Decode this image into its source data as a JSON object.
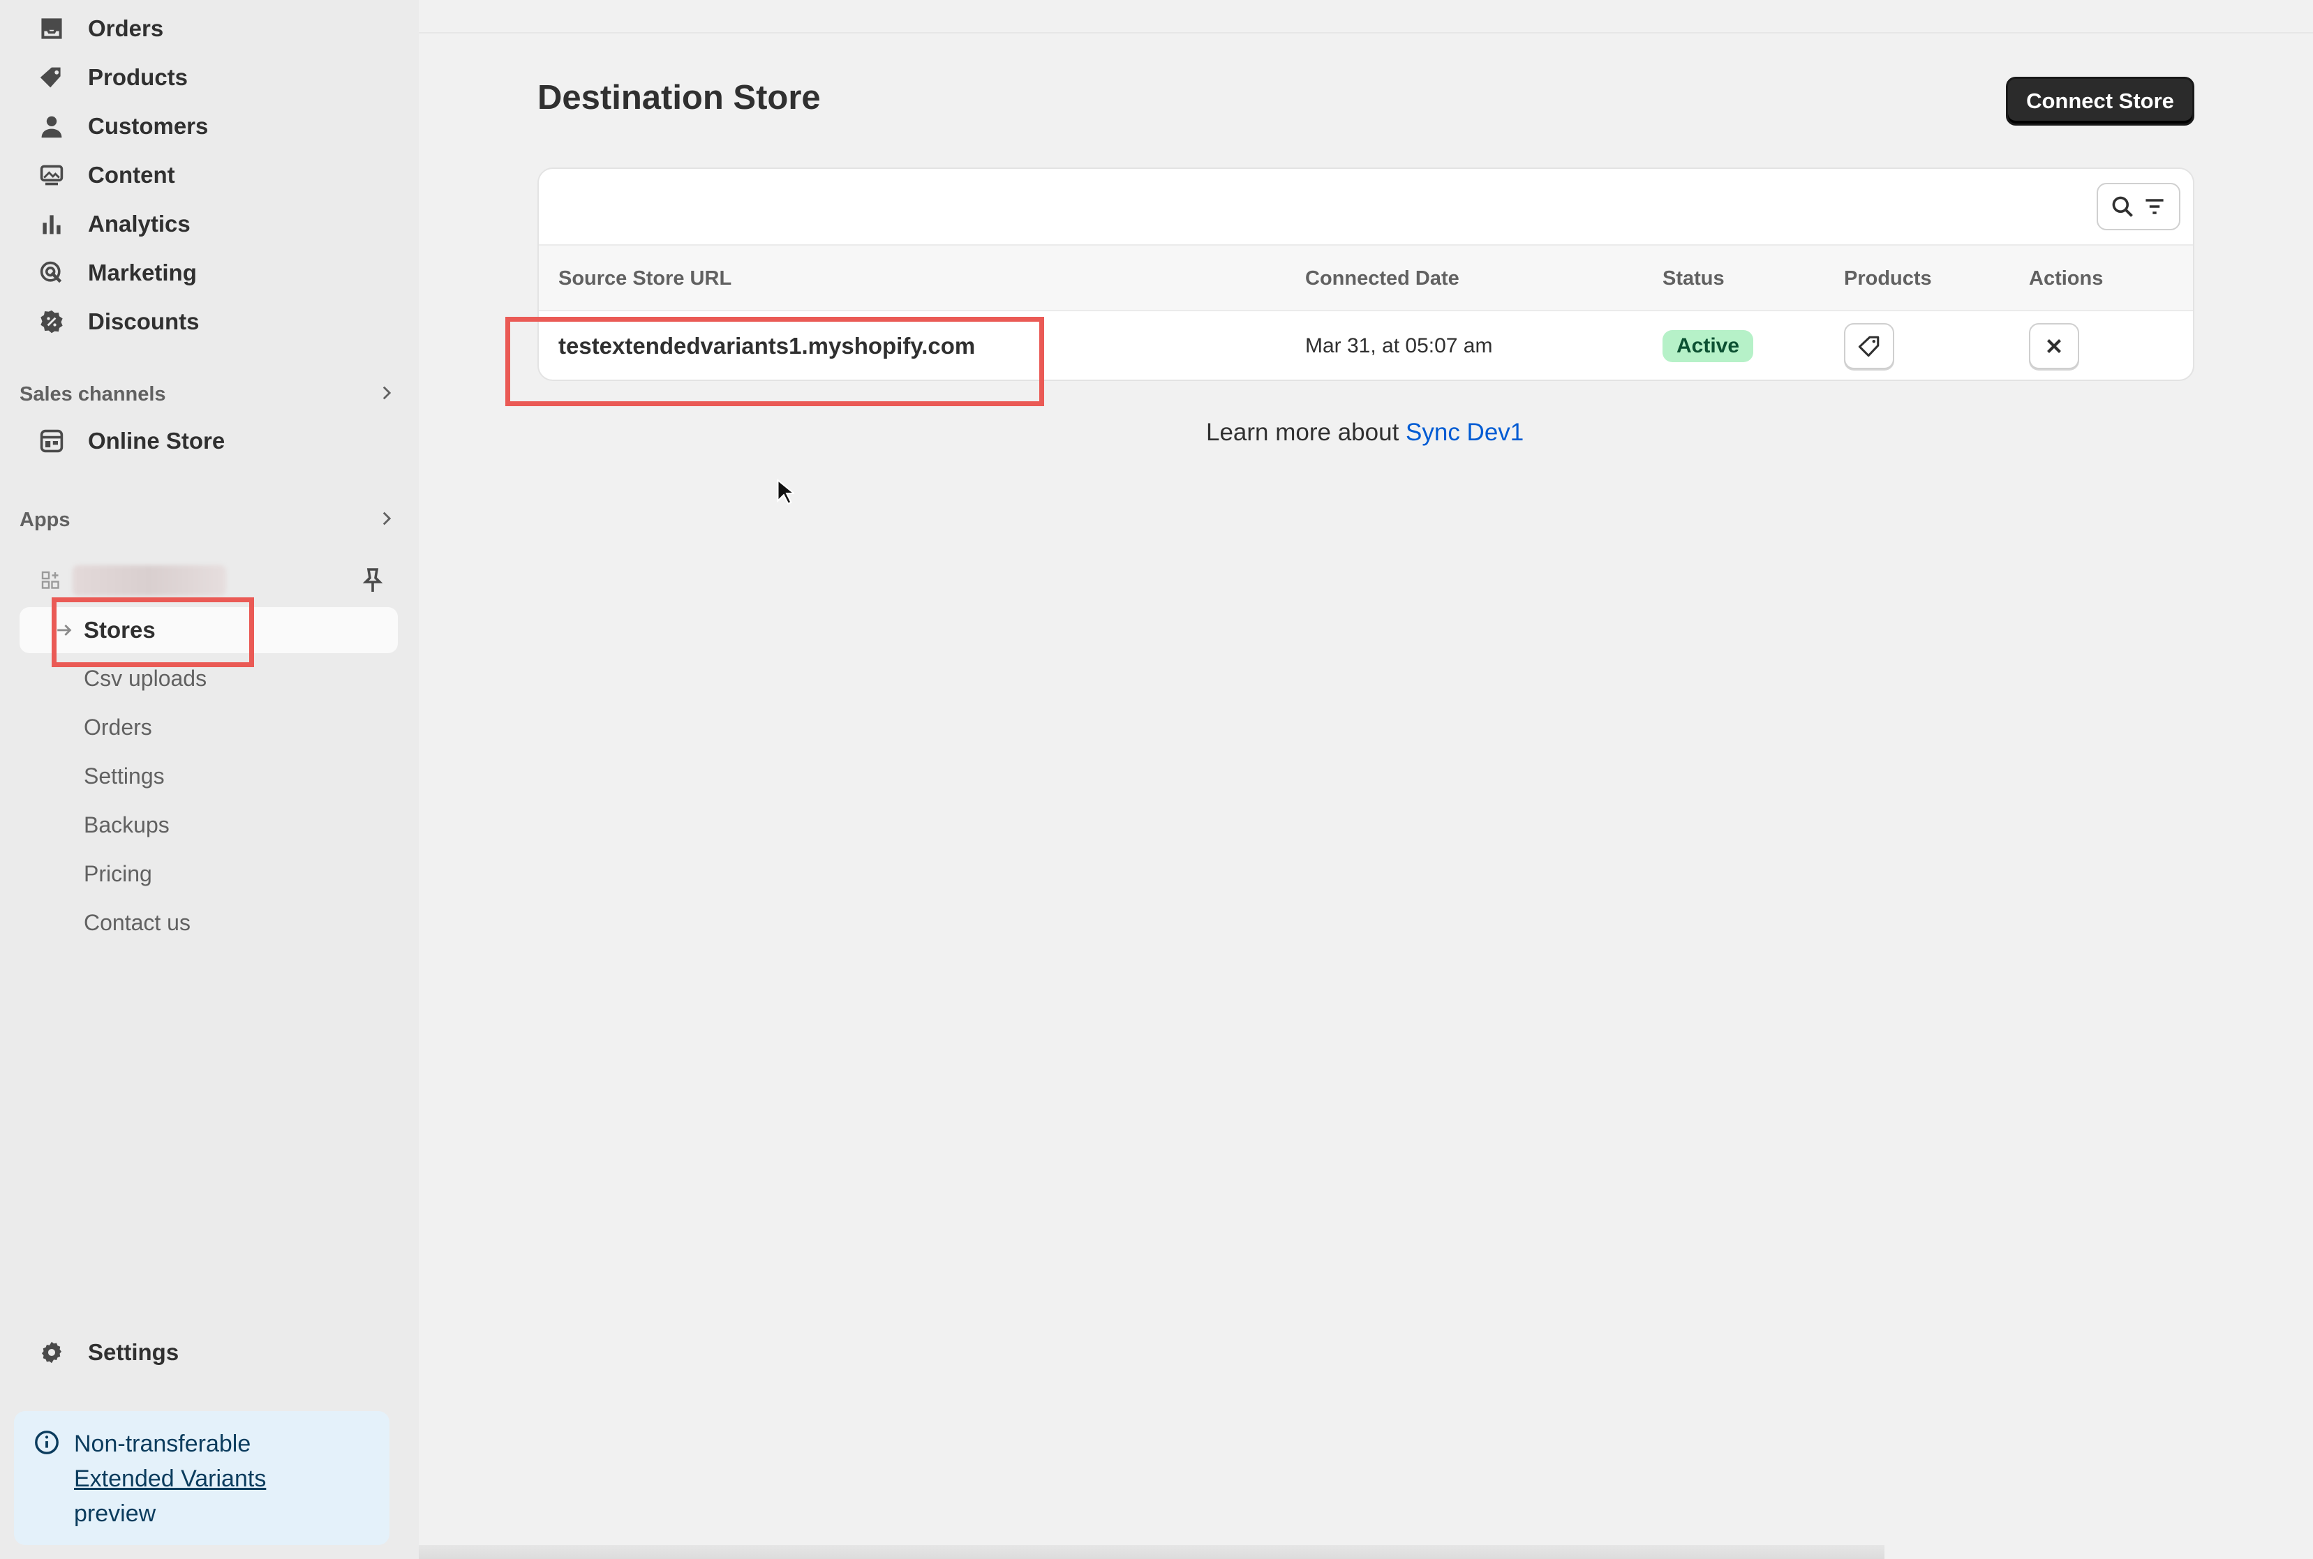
{
  "sidebar": {
    "nav": [
      {
        "label": "Orders",
        "icon": "inbox-icon"
      },
      {
        "label": "Products",
        "icon": "tag-icon"
      },
      {
        "label": "Customers",
        "icon": "person-icon"
      },
      {
        "label": "Content",
        "icon": "image-icon"
      },
      {
        "label": "Analytics",
        "icon": "bar-chart-icon"
      },
      {
        "label": "Marketing",
        "icon": "target-icon"
      },
      {
        "label": "Discounts",
        "icon": "discount-icon"
      }
    ],
    "sales_channels": {
      "label": "Sales channels",
      "items": [
        {
          "label": "Online Store",
          "icon": "store-icon"
        }
      ]
    },
    "apps": {
      "label": "Apps",
      "active_item": "Stores",
      "sub_items": [
        "Csv uploads",
        "Orders",
        "Settings",
        "Backups",
        "Pricing",
        "Contact us"
      ]
    },
    "settings_label": "Settings",
    "notice": {
      "line1": "Non-transferable",
      "link": "Extended Variants",
      "line3": "preview"
    }
  },
  "main": {
    "title": "Destination Store",
    "connect_button": "Connect Store",
    "table": {
      "headers": [
        "Source Store URL",
        "Connected Date",
        "Status",
        "Products",
        "Actions"
      ],
      "rows": [
        {
          "url": "testextendedvariants1.myshopify.com",
          "date": "Mar 31, at 05:07 am",
          "status": "Active"
        }
      ]
    },
    "learn_more": {
      "text": "Learn more about ",
      "link": "Sync Dev1"
    }
  },
  "colors": {
    "accent_link": "#005bd3",
    "badge_bg": "#b6f1c8",
    "highlight": "#ea5a55"
  }
}
